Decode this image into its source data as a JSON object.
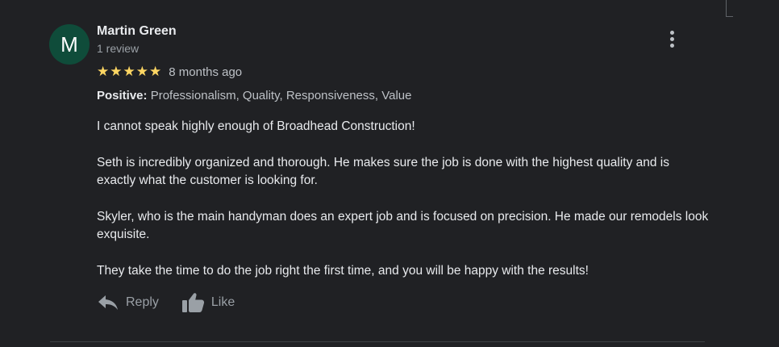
{
  "review": {
    "avatar_letter": "M",
    "author_name": "Martin Green",
    "author_meta": "1 review",
    "rating": 5,
    "rating_max": 5,
    "star_glyph": "★",
    "date": "8 months ago",
    "attributes_label": "Positive:",
    "attributes_value": "Professionalism, Quality, Responsiveness, Value",
    "paragraphs": [
      "I cannot speak highly enough of Broadhead Construction!",
      "Seth is incredibly organized and thorough.  He makes sure the job is done with the highest quality and is exactly what the customer is looking for.",
      "Skyler, who is the main handyman does an expert job and is focused on precision.  He made our remodels look exquisite.",
      "They take the time to do the job right the first time, and you will be happy with the results!"
    ]
  },
  "actions": {
    "reply_label": "Reply",
    "like_label": "Like"
  },
  "colors": {
    "background": "#202124",
    "avatar_bg": "#0f4c3a",
    "star": "#fdd663",
    "primary_text": "#e8eaed",
    "secondary_text": "#9aa0a6"
  },
  "icons": {
    "more": "more-vert-icon",
    "reply": "reply-arrow-icon",
    "like": "thumbs-up-icon",
    "star": "star-icon"
  }
}
